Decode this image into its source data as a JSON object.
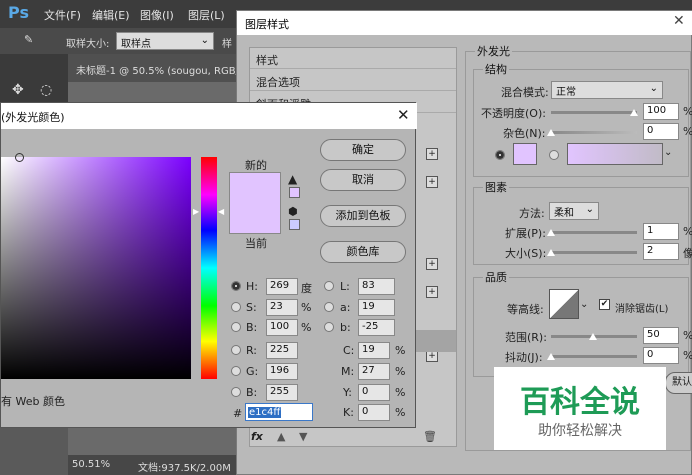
{
  "ps": {
    "logo": "Ps",
    "menu": [
      "文件(F)",
      "编辑(E)",
      "图像(I)",
      "图层(L)"
    ],
    "options": {
      "sample_label": "取样大小:",
      "sample_value": "取样点",
      "more": "样"
    },
    "doc_tab": "未标题-1 @ 50.5% (sougou, RGB/",
    "status": {
      "zoom": "50.51%",
      "doc": "文档:937.5K/2.00M"
    }
  },
  "layer_style": {
    "title": "图层样式",
    "left_items": [
      "样式",
      "混合选项",
      "斜面和浮雕"
    ],
    "outer_glow": "外发光",
    "structure": "结构",
    "blend_mode_label": "混合模式:",
    "blend_mode_value": "正常",
    "opacity_label": "不透明度(O):",
    "opacity_value": "100",
    "noise_label": "杂色(N):",
    "noise_value": "0",
    "percent": "%",
    "elements": "图素",
    "method_label": "方法:",
    "method_value": "柔和",
    "spread_label": "扩展(P):",
    "spread_value": "1",
    "size_label": "大小(S):",
    "size_value": "2",
    "px": "像",
    "quality": "品质",
    "contour_label": "等高线:",
    "antialias_label": "消除锯齿(L)",
    "range_label": "范围(R):",
    "range_value": "50",
    "jitter_label": "抖动(J):",
    "jitter_value": "0",
    "default_btn": "默认值",
    "fx": "fx"
  },
  "color_picker": {
    "title": "(外发光颜色)",
    "new_label": "新的",
    "current_label": "当前",
    "ok": "确定",
    "cancel": "取消",
    "add_swatch": "添加到色板",
    "libraries": "颜色库",
    "web_only": "有 Web 颜色",
    "H": {
      "label": "H:",
      "value": "269",
      "unit": "度"
    },
    "S": {
      "label": "S:",
      "value": "23",
      "unit": "%"
    },
    "Bv": {
      "label": "B:",
      "value": "100",
      "unit": "%"
    },
    "R": {
      "label": "R:",
      "value": "225"
    },
    "G": {
      "label": "G:",
      "value": "196"
    },
    "Bc": {
      "label": "B:",
      "value": "255"
    },
    "L": {
      "label": "L:",
      "value": "83"
    },
    "a": {
      "label": "a:",
      "value": "19"
    },
    "b": {
      "label": "b:",
      "value": "-25"
    },
    "C": {
      "label": "C:",
      "value": "19",
      "unit": "%"
    },
    "M": {
      "label": "M:",
      "value": "27",
      "unit": "%"
    },
    "Y": {
      "label": "Y:",
      "value": "0",
      "unit": "%"
    },
    "K": {
      "label": "K:",
      "value": "0",
      "unit": "%"
    },
    "hex_label": "#",
    "hex_value": "e1c4ff",
    "color": "#e1c4ff"
  },
  "watermark": {
    "title": "百科全说",
    "subtitle": "助你轻松解决"
  }
}
